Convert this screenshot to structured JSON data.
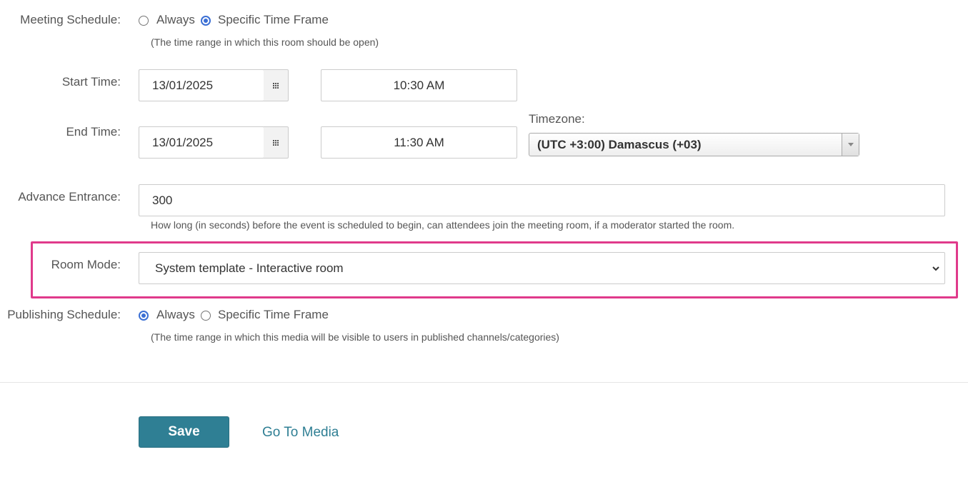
{
  "meeting_schedule": {
    "label": "Meeting Schedule:",
    "option_always": "Always",
    "option_specific": "Specific Time Frame",
    "selected": "specific",
    "hint": "(The time range in which this room should be open)"
  },
  "start_time": {
    "label": "Start Time:",
    "date": "13/01/2025",
    "time": "10:30 AM"
  },
  "end_time": {
    "label": "End Time:",
    "date": "13/01/2025",
    "time": "11:30 AM"
  },
  "timezone": {
    "label": "Timezone:",
    "value": "(UTC +3:00) Damascus (+03)"
  },
  "advance_entrance": {
    "label": "Advance Entrance:",
    "value": "300",
    "hint": "How long (in seconds) before the event is scheduled to begin, can attendees join the meeting room, if a moderator started the room."
  },
  "room_mode": {
    "label": "Room Mode:",
    "value": "System template - Interactive room",
    "highlight_color": "#e03a8b"
  },
  "publishing_schedule": {
    "label": "Publishing Schedule:",
    "option_always": "Always",
    "option_specific": "Specific Time Frame",
    "selected": "always",
    "hint": "(The time range in which this media will be visible to users in published channels/categories)"
  },
  "actions": {
    "save_label": "Save",
    "go_to_media_label": "Go To Media",
    "accent": "#2f7f94"
  },
  "icons": {
    "calendar": "calendar-grid-icon",
    "select_arrow": "chevron-down-icon"
  }
}
